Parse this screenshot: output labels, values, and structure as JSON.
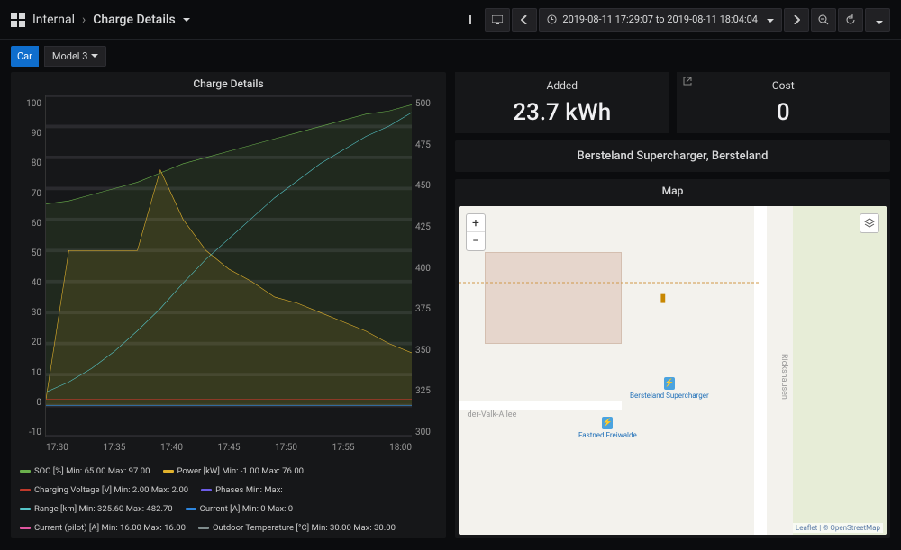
{
  "breadcrumb": {
    "folder": "Internal",
    "title": "Charge Details"
  },
  "time_range": {
    "label": "2019-08-11 17:29:07 to 2019-08-11 18:04:04"
  },
  "variable": {
    "name": "Car",
    "value": "Model 3"
  },
  "stats": {
    "added": {
      "label": "Added",
      "value": "23.7 kWh"
    },
    "cost": {
      "label": "Cost",
      "value": "0"
    }
  },
  "location": "Bersteland Supercharger, Bersteland",
  "map": {
    "title": "Map",
    "zoom_in": "+",
    "zoom_out": "−",
    "poi1": "Bersteland Supercharger",
    "poi2": "Fastned Freiwalde",
    "road_v": "Rickshausen",
    "road_h": "der-Valk-Allee",
    "attrib": "Leaflet | © OpenStreetMap"
  },
  "chart": {
    "title": "Charge Details",
    "y_left": {
      "min": -10,
      "max": 100,
      "step": 10,
      "ticks": [
        "100",
        "90",
        "80",
        "70",
        "60",
        "50",
        "40",
        "30",
        "20",
        "10",
        "0",
        "-10"
      ]
    },
    "y_right": {
      "min": 300,
      "max": 500,
      "step": 25,
      "ticks": [
        "500",
        "475",
        "450",
        "425",
        "400",
        "375",
        "350",
        "325",
        "300"
      ]
    },
    "x_ticks": [
      "17:30",
      "17:35",
      "17:40",
      "17:45",
      "17:50",
      "17:55",
      "18:00"
    ],
    "legend": [
      {
        "name": "SOC [%]",
        "color": "#6ab04c",
        "stats": "Min: 65.00  Max: 97.00"
      },
      {
        "name": "Power [kW]",
        "color": "#e1b12c",
        "stats": "Min: -1.00  Max: 76.00"
      },
      {
        "name": "Charging Voltage [V]",
        "color": "#c0392b",
        "stats": "Min: 2.00  Max: 2.00"
      },
      {
        "name": "Phases",
        "color": "#6c5ce7",
        "stats": "Min:   Max: "
      },
      {
        "name": "Range [km]",
        "color": "#56c6c9",
        "stats": "Min: 325.60  Max: 482.70"
      },
      {
        "name": "Current [A]",
        "color": "#2e86de",
        "stats": "Min: 0  Max: 0"
      },
      {
        "name": "Current (pilot) [A]",
        "color": "#e056a0",
        "stats": "Min: 16.00  Max: 16.00"
      },
      {
        "name": "Outdoor Temperature [°C]",
        "color": "#7f8c8d",
        "stats": "Min: 30.00  Max: 30.00"
      }
    ]
  },
  "chart_data": {
    "type": "line",
    "x": [
      1050,
      1052,
      1054,
      1056,
      1058,
      1060,
      1062,
      1064,
      1066,
      1068,
      1070,
      1072,
      1074,
      1076,
      1078,
      1080,
      1082
    ],
    "x_display": [
      "17:30",
      "17:32",
      "17:34",
      "17:36",
      "17:38",
      "17:40",
      "17:42",
      "17:44",
      "17:46",
      "17:48",
      "17:50",
      "17:52",
      "17:54",
      "17:56",
      "17:58",
      "18:00",
      "18:02"
    ],
    "series": [
      {
        "name": "SOC [%]",
        "axis": "left",
        "color": "#6ab04c",
        "values": [
          65,
          66,
          68,
          70,
          72,
          75,
          78,
          80,
          82,
          84,
          86,
          88,
          90,
          92,
          94,
          95,
          97
        ]
      },
      {
        "name": "Power [kW]",
        "axis": "left",
        "color": "#e1b12c",
        "values": [
          2,
          50,
          50,
          50,
          50,
          76,
          60,
          50,
          44,
          40,
          35,
          33,
          30,
          27,
          24,
          20,
          17
        ]
      },
      {
        "name": "Range [km]",
        "axis": "right",
        "color": "#56c6c9",
        "values": [
          326,
          332,
          340,
          350,
          362,
          375,
          390,
          404,
          416,
          428,
          440,
          450,
          460,
          468,
          476,
          482,
          490
        ]
      },
      {
        "name": "Current (pilot) [A]",
        "axis": "left",
        "color": "#e056a0",
        "values": [
          16,
          16,
          16,
          16,
          16,
          16,
          16,
          16,
          16,
          16,
          16,
          16,
          16,
          16,
          16,
          16,
          16
        ]
      },
      {
        "name": "Charging Voltage [V]",
        "axis": "left",
        "color": "#c0392b",
        "values": [
          2,
          2,
          2,
          2,
          2,
          2,
          2,
          2,
          2,
          2,
          2,
          2,
          2,
          2,
          2,
          2,
          2
        ]
      },
      {
        "name": "Current [A]",
        "axis": "left",
        "color": "#2e86de",
        "values": [
          0,
          0,
          0,
          0,
          0,
          0,
          0,
          0,
          0,
          0,
          0,
          0,
          0,
          0,
          0,
          0,
          0
        ]
      }
    ],
    "y_left": {
      "min": -10,
      "max": 100
    },
    "y_right": {
      "min": 300,
      "max": 500
    },
    "title": "Charge Details",
    "xlabel": "",
    "ylabel_left": "",
    "ylabel_right": ""
  }
}
